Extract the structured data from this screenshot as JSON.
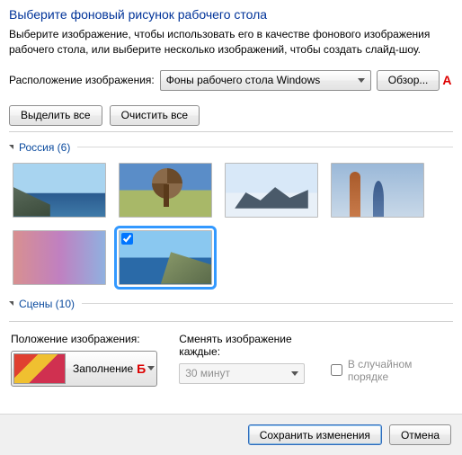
{
  "title": "Выберите фоновый рисунок рабочего стола",
  "subtitle": "Выберите изображение, чтобы использовать его в качестве фонового изображения рабочего стола, или выберите несколько изображений, чтобы создать слайд-шоу.",
  "location": {
    "label": "Расположение изображения:",
    "value": "Фоны рабочего стола Windows",
    "browse_label": "Обзор...",
    "browse_marker": "А"
  },
  "toolbar": {
    "select_all": "Выделить все",
    "clear_all": "Очистить все"
  },
  "groups": [
    {
      "name": "Россия",
      "count": 6,
      "label": "Россия (6)"
    },
    {
      "name": "Сцены",
      "count": 10,
      "label": "Сцены (10)"
    }
  ],
  "position": {
    "label": "Положение изображения:",
    "value": "Заполнение",
    "marker": "Б"
  },
  "interval": {
    "label": "Сменять изображение каждые:",
    "value": "30 минут"
  },
  "shuffle": {
    "label": "В случайном порядке",
    "checked": false
  },
  "footer": {
    "save": "Сохранить изменения",
    "cancel": "Отмена"
  }
}
